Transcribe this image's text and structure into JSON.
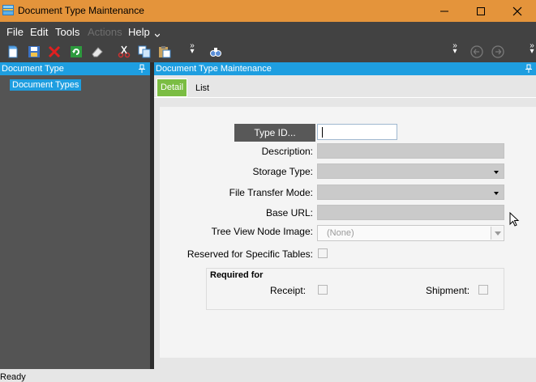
{
  "window": {
    "title": "Document Type Maintenance"
  },
  "menu": [
    {
      "label": "File",
      "enabled": true
    },
    {
      "label": "Edit",
      "enabled": true
    },
    {
      "label": "Tools",
      "enabled": true
    },
    {
      "label": "Actions",
      "enabled": false
    },
    {
      "label": "Help",
      "enabled": true
    }
  ],
  "toolbar": {
    "icons": [
      "new-document-icon",
      "save-icon",
      "delete-icon",
      "refresh-icon",
      "eraser-icon",
      "cut-icon",
      "copy-icon",
      "paste-icon",
      "find-icon",
      "back-arrow-icon",
      "forward-arrow-icon"
    ]
  },
  "left_pane": {
    "header": "Document Type",
    "tree": [
      "Document Types"
    ]
  },
  "right_pane": {
    "header": "Document Type Maintenance",
    "tabs": [
      {
        "label": "Detail",
        "active": true
      },
      {
        "label": "List",
        "active": false
      }
    ]
  },
  "form": {
    "type_id_button": "Type ID...",
    "type_id_value": "",
    "description_label": "Description:",
    "storage_type_label": "Storage Type:",
    "file_transfer_mode_label": "File Transfer Mode:",
    "base_url_label": "Base URL:",
    "tree_view_node_image_label": "Tree View Node Image:",
    "tree_view_node_image_value": "(None)",
    "reserved_label": "Reserved for Specific Tables:",
    "required_for": {
      "title": "Required for",
      "receipt_label": "Receipt:",
      "shipment_label": "Shipment:"
    }
  },
  "status": {
    "text": "Ready"
  },
  "colors": {
    "titlebar": "#e4943b",
    "menubar": "#424242",
    "pane_header": "#1e9ee0",
    "active_tab": "#7bbd43"
  }
}
